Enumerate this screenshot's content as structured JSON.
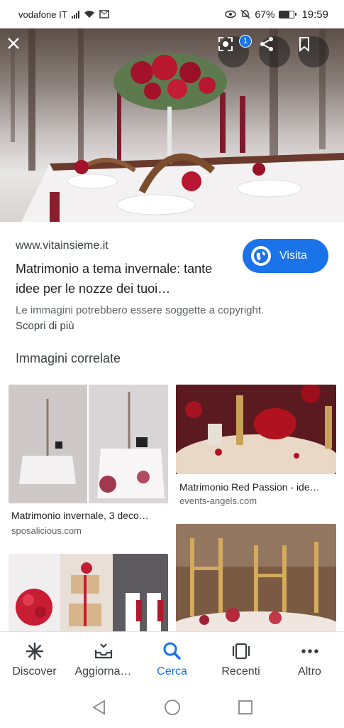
{
  "status_bar": {
    "carrier": "vodafone IT",
    "battery": "67%",
    "time": "19:59"
  },
  "hero": {
    "close_icon": "close-icon",
    "lens_badge": "1"
  },
  "result": {
    "site": "www.vitainsieme.it",
    "title": "Matrimonio a tema invernale: tante idee per le nozze dei tuoi…",
    "visit_label": "Visita",
    "copyright": "Le immagini potrebbero essere soggette a copyright.",
    "learn_more": "Scopri di più"
  },
  "related": {
    "heading": "Immagini correlate",
    "items": [
      {
        "caption": "Matrimonio invernale, 3 deco…",
        "source": "sposalicious.com"
      },
      {
        "caption": "Matrimonio Red Passion - ide…",
        "source": "events-angels.com"
      }
    ]
  },
  "bottom_nav": {
    "items": [
      {
        "label": "Discover"
      },
      {
        "label": "Aggiorna…"
      },
      {
        "label": "Cerca"
      },
      {
        "label": "Recenti"
      },
      {
        "label": "Altro"
      }
    ],
    "active": "Cerca",
    "accent": "#1a73e8"
  }
}
